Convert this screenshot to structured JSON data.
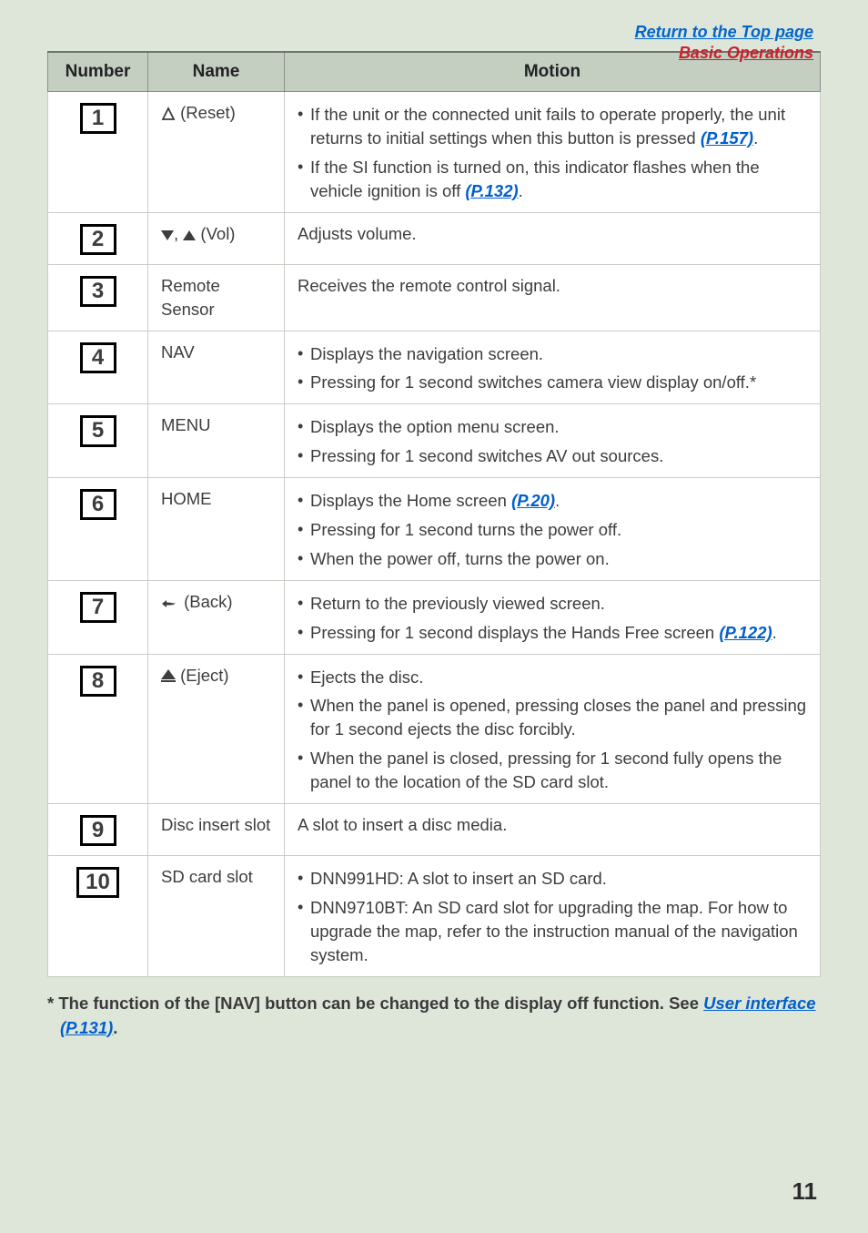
{
  "top_links": {
    "return": "Return to the Top page",
    "section": "Basic Operations"
  },
  "headers": {
    "number": "Number",
    "name": "Name",
    "motion": "Motion"
  },
  "rows": [
    {
      "num": "1",
      "name_suffix": " (Reset)",
      "bullets": [
        {
          "pre": "If the unit or the connected unit fails to operate properly, the unit returns to initial settings when this button is pressed ",
          "ref": "(P.157)",
          "post": "."
        },
        {
          "pre": "If the SI function is turned on, this indicator flashes when the vehicle ignition is off ",
          "ref": "(P.132)",
          "post": "."
        }
      ]
    },
    {
      "num": "2",
      "name_suffix": " (Vol)",
      "plain": "Adjusts volume."
    },
    {
      "num": "3",
      "name": "Remote Sensor",
      "plain": "Receives the remote control signal."
    },
    {
      "num": "4",
      "name": "NAV",
      "bullets": [
        {
          "pre": "Displays the navigation screen."
        },
        {
          "pre": "Pressing for 1 second switches camera view display on/off.*"
        }
      ]
    },
    {
      "num": "5",
      "name": "MENU",
      "bullets": [
        {
          "pre": "Displays the option menu screen."
        },
        {
          "pre": "Pressing for 1 second switches AV out sources."
        }
      ]
    },
    {
      "num": "6",
      "name": "HOME",
      "bullets": [
        {
          "pre": "Displays the Home screen ",
          "ref": "(P.20)",
          "post": "."
        },
        {
          "pre": "Pressing for 1 second turns the power off."
        },
        {
          "pre": "When the power off, turns the power on."
        }
      ]
    },
    {
      "num": "7",
      "name_suffix": " (Back)",
      "bullets": [
        {
          "pre": "Return to the previously viewed screen."
        },
        {
          "pre": "Pressing for 1 second displays the Hands Free screen ",
          "ref": "(P.122)",
          "post": "."
        }
      ]
    },
    {
      "num": "8",
      "name_suffix": " (Eject)",
      "bullets": [
        {
          "pre": "Ejects the disc."
        },
        {
          "pre": "When the panel is opened, pressing closes the panel and pressing for 1 second ejects the disc forcibly."
        },
        {
          "pre": "When the panel is closed, pressing for 1 second fully opens the panel to the location of the SD card slot."
        }
      ]
    },
    {
      "num": "9",
      "name": "Disc insert slot",
      "plain": "A slot to insert a disc media."
    },
    {
      "num": "10",
      "name": "SD card slot",
      "bullets": [
        {
          "pre": "DNN991HD: A slot to insert an SD card."
        },
        {
          "pre": "DNN9710BT: An SD card slot for upgrading the map. For how to upgrade the map, refer to the instruction manual of the navigation system."
        }
      ]
    }
  ],
  "footnote": {
    "pre": "* The function of the [NAV] button can be changed to the display off function. See ",
    "ref": "User interface (P.131)",
    "post": "."
  },
  "page_number": "11"
}
